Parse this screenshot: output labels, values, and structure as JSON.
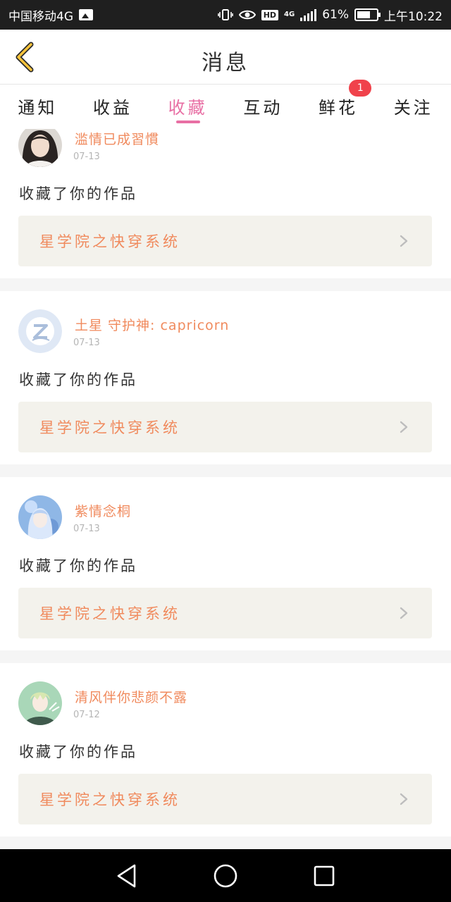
{
  "status_bar": {
    "carrier": "中国移动4G",
    "net_type": "4G",
    "hd": "HD",
    "battery": "61%",
    "time": "上午10:22"
  },
  "header": {
    "title": "消息"
  },
  "tabs": [
    {
      "label": "通知",
      "active": false
    },
    {
      "label": "收益",
      "active": false
    },
    {
      "label": "收藏",
      "active": true
    },
    {
      "label": "互动",
      "active": false
    },
    {
      "label": "鲜花",
      "active": false,
      "badge": "1"
    },
    {
      "label": "关注",
      "active": false
    }
  ],
  "feed": [
    {
      "username": "滥情已成習慣",
      "date": "07-13",
      "action": "收藏了你的作品",
      "work_title": "星学院之快穿系统",
      "avatar": "photo-girl"
    },
    {
      "username": "土星 守护神: capricorn",
      "date": "07-13",
      "action": "收藏了你的作品",
      "work_title": "星学院之快穿系统",
      "avatar": "default-z"
    },
    {
      "username": "紫情念桐",
      "date": "07-13",
      "action": "收藏了你的作品",
      "work_title": "星学院之快穿系统",
      "avatar": "anime-blue"
    },
    {
      "username": "清风伴你悲颜不露",
      "date": "07-12",
      "action": "收藏了你的作品",
      "work_title": "星学院之快穿系统",
      "avatar": "anime-green"
    }
  ],
  "colors": {
    "accent_pink": "#e86fa4",
    "username_orange": "#f08a5d",
    "badge_red": "#f0424b",
    "work_box_bg": "#f3f2ec"
  }
}
